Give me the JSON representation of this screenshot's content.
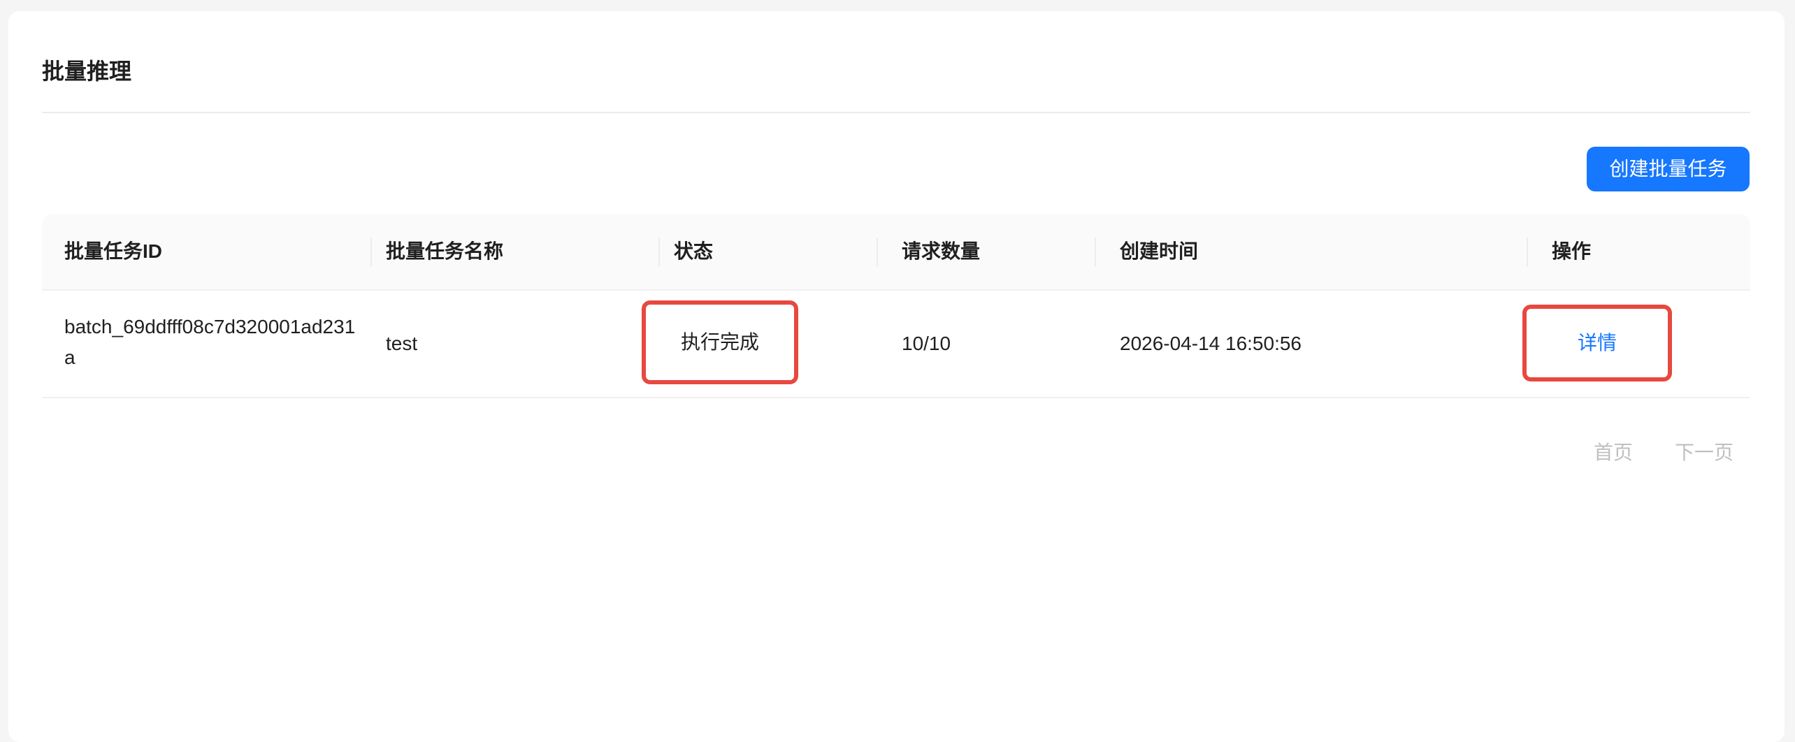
{
  "page": {
    "title": "批量推理"
  },
  "toolbar": {
    "create_label": "创建批量任务"
  },
  "table": {
    "columns": [
      "批量任务ID",
      "批量任务名称",
      "状态",
      "请求数量",
      "创建时间",
      "操作"
    ],
    "rows": [
      {
        "id": "batch_69ddfff08c7d320001ad231a",
        "name": "test",
        "status": "执行完成",
        "request_count": "10/10",
        "created_at": "2026-04-14 16:50:56",
        "action": "详情"
      }
    ]
  },
  "pagination": {
    "first": "首页",
    "next": "下一页"
  },
  "colors": {
    "primary": "#1677ff",
    "highlight": "#e8483f",
    "disabled": "#bfbfbf"
  }
}
